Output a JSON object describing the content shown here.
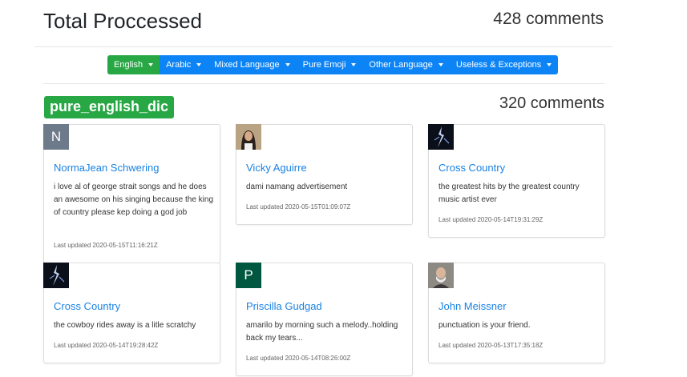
{
  "header": {
    "title": "Total Proccessed",
    "count": "428 comments"
  },
  "nav": [
    {
      "label": "English",
      "active": true
    },
    {
      "label": "Arabic"
    },
    {
      "label": "Mixed Language"
    },
    {
      "label": "Pure Emoji"
    },
    {
      "label": "Other Language"
    },
    {
      "label": "Useless & Exceptions"
    }
  ],
  "section": {
    "badge": "pure_english_dic",
    "count": "320 comments"
  },
  "cards": [
    {
      "avatar_letter": "N",
      "avatar_color": "#6c7a89",
      "name": "NormaJean Schwering",
      "comment": "i love al of george strait songs and he does an awesome on his singing because the king of country please kep doing a god job",
      "updated": "Last updated 2020-05-15T11:16:21Z"
    },
    {
      "avatar_icon": "woman-photo-icon",
      "name": "Vicky Aguirre",
      "comment": "dami namang advertisement",
      "updated": "Last updated 2020-05-15T01:09:07Z"
    },
    {
      "avatar_icon": "lightning-photo-icon",
      "name": "Cross Country",
      "comment": "the greatest hits by the greatest country music artist ever",
      "updated": "Last updated 2020-05-14T19:31:29Z"
    },
    {
      "avatar_icon": "lightning-photo-icon",
      "name": "Cross Country",
      "comment": "the cowboy rides away is a litle scratchy",
      "updated": "Last updated 2020-05-14T19:28:42Z"
    },
    {
      "avatar_letter": "P",
      "avatar_color": "#00573f",
      "name": "Priscilla Gudgad",
      "comment": "amarilo by morning such a melody..holding back my tears...",
      "updated": "Last updated 2020-05-14T08:26:00Z"
    },
    {
      "avatar_icon": "man-photo-icon",
      "name": "John Meissner",
      "comment": "punctuation is your friend.",
      "updated": "Last updated 2020-05-13T17:35:18Z"
    }
  ]
}
